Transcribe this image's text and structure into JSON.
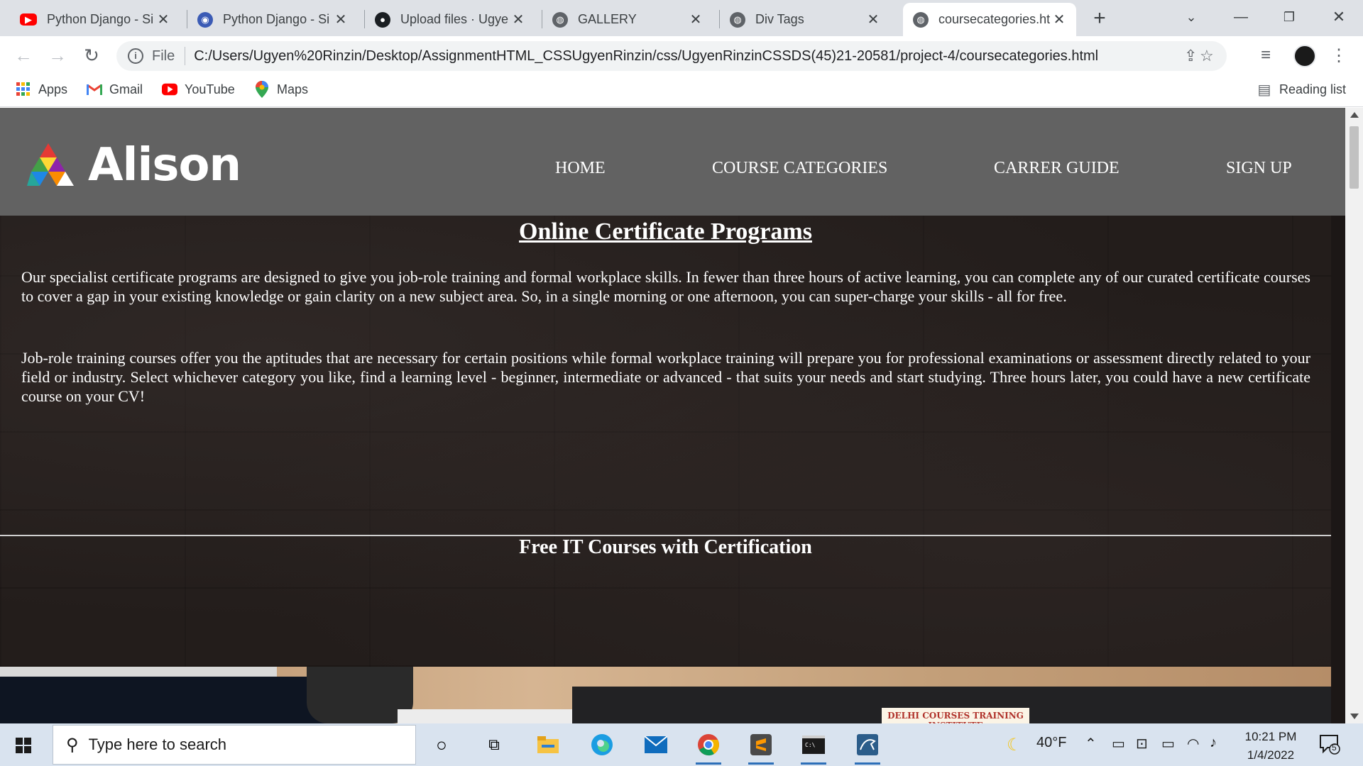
{
  "browser": {
    "tabs": [
      {
        "title": "Python Django - Si",
        "favicon": "youtube-icon"
      },
      {
        "title": "Python Django - Si",
        "favicon": "django-icon"
      },
      {
        "title": "Upload files · Ugye",
        "favicon": "github-icon"
      },
      {
        "title": "GALLERY",
        "favicon": "globe-icon"
      },
      {
        "title": "Div Tags",
        "favicon": "globe-icon"
      },
      {
        "title": "coursecategories.ht",
        "favicon": "globe-icon"
      }
    ],
    "active_tab_index": 5,
    "address": {
      "scheme_label": "File",
      "url": "C:/Users/Ugyen%20Rinzin/Desktop/AssignmentHTML_CSSUgyenRinzin/css/UgyenRinzinCSSDS(45)21-20581/project-4/coursecategories.html"
    },
    "bookmarks": [
      {
        "label": "Apps",
        "icon": "apps-grid-icon"
      },
      {
        "label": "Gmail",
        "icon": "gmail-icon"
      },
      {
        "label": "YouTube",
        "icon": "youtube-icon"
      },
      {
        "label": "Maps",
        "icon": "maps-icon"
      }
    ],
    "reading_list_label": "Reading list"
  },
  "site": {
    "logo_text": "Alison",
    "nav": [
      "HOME",
      "COURSE CATEGORIES",
      "CARRER GUIDE",
      "SIGN UP"
    ],
    "heading": "Online Certificate Programs",
    "paragraphs": [
      "Our specialist certificate programs are designed to give you job-role training and formal workplace skills. In fewer than three hours of active learning, you can complete any of our curated certificate courses to cover a gap in your existing knowledge or gain clarity on a new subject area. So, in a single morning or one afternoon, you can super-charge your skills - all for free.",
      "Job-role training courses offer you the aptitudes that are necessary for certain positions while formal workplace training will prepare you for professional examinations or assessment directly related to your field or industry. Select whichever category you like, find a learning level - beginner, intermediate or advanced - that suits your needs and start studying. Three hours later, you could have a new certificate course on your CV!"
    ],
    "subheading": "Free IT Courses with Certification",
    "banner_poster_text": "DELHI COURSES TRAINING INSTITUTE"
  },
  "taskbar": {
    "search_placeholder": "Type here to search",
    "weather": "40°F",
    "time": "10:21 PM",
    "date": "1/4/2022",
    "notification_count": "5"
  },
  "colors": {
    "header_bg": "#626262",
    "hero_bg": "#231d1b",
    "tabstrip_bg": "#dee1e6",
    "taskbar_bg": "#d9e3ef"
  }
}
